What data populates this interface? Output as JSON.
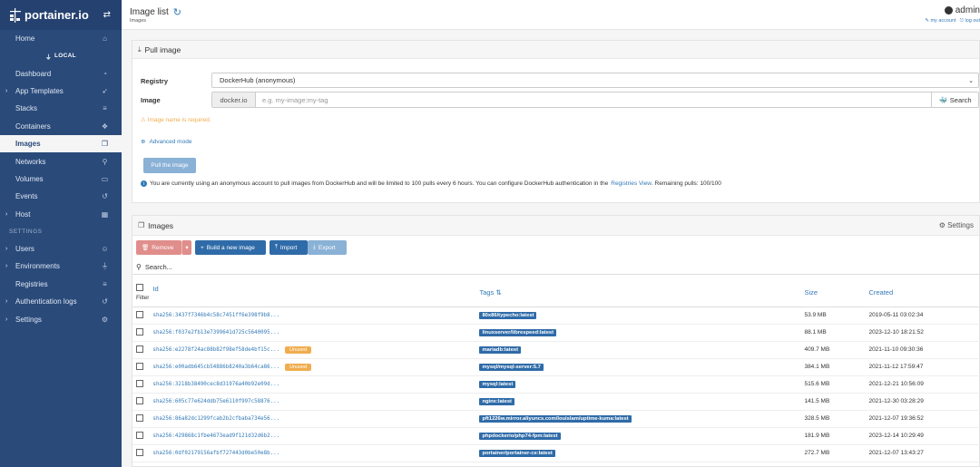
{
  "app": {
    "name": "portainer.io"
  },
  "sidebar": {
    "local_label": "LOCAL",
    "settings_section": "SETTINGS",
    "items": [
      {
        "label": "Home",
        "icon": "home-icon",
        "glyph": "⌂"
      },
      {
        "label": "Dashboard",
        "icon": "tachometer-icon",
        "glyph": "◔"
      },
      {
        "label": "App Templates",
        "icon": "rocket-icon",
        "glyph": "➶"
      },
      {
        "label": "Stacks",
        "icon": "list-icon",
        "glyph": "≡"
      },
      {
        "label": "Containers",
        "icon": "cubes-icon",
        "glyph": "❖"
      },
      {
        "label": "Images",
        "icon": "clone-icon",
        "glyph": "❐"
      },
      {
        "label": "Networks",
        "icon": "sitemap-icon",
        "glyph": "⚲"
      },
      {
        "label": "Volumes",
        "icon": "hdd-icon",
        "glyph": "▭"
      },
      {
        "label": "Events",
        "icon": "history-icon",
        "glyph": "↺"
      },
      {
        "label": "Host",
        "icon": "th-icon",
        "glyph": "▦"
      },
      {
        "label": "Users",
        "icon": "users-icon",
        "glyph": "☺"
      },
      {
        "label": "Environments",
        "icon": "plug-icon",
        "glyph": "⏚"
      },
      {
        "label": "Registries",
        "icon": "database-icon",
        "glyph": "≡"
      },
      {
        "label": "Authentication logs",
        "icon": "history-icon",
        "glyph": "↺"
      },
      {
        "label": "Settings",
        "icon": "cogs-icon",
        "glyph": "⚙"
      }
    ]
  },
  "header": {
    "title": "Image list",
    "subtitle": "Images",
    "user": "admin",
    "my_account": "my account",
    "log_out": "log out"
  },
  "pull": {
    "title": "Pull image",
    "registry_label": "Registry",
    "registry_value": "DockerHub (anonymous)",
    "image_label": "Image",
    "image_prefix": "docker.io",
    "image_placeholder": "e.g. my-image:my-tag",
    "search_label": "Search",
    "warning": "Image name is required.",
    "advanced_mode": "Advanced mode",
    "pull_button": "Pull the image",
    "info_text": "You are currently using an anonymous account to pull images from DockerHub and will be limited to 100 pulls every 6 hours. You can configure DockerHub authentication in the",
    "info_link": "Registries View",
    "info_remaining": ". Remaining pulls: 100/100"
  },
  "images": {
    "title": "Images",
    "settings_label": "Settings",
    "toolbar": {
      "remove": "Remove",
      "build": "Build a new image",
      "import": "Import",
      "export": "Export"
    },
    "search_placeholder": "Search...",
    "columns": {
      "id": "Id",
      "filter": "Filter",
      "tags": "Tags",
      "size": "Size",
      "created": "Created"
    },
    "rows": [
      {
        "id": "sha256:3437f7346b4c58c7451ff6e398f9b8...",
        "unused": "",
        "tag": "80x86/typecho:latest",
        "size": "53.9 MB",
        "created": "2019-05-11 03:02:34"
      },
      {
        "id": "sha256:f037e2fb13e7399641d725c5640095...",
        "unused": "",
        "tag": "linuxserver/librespeed:latest",
        "size": "88.1 MB",
        "created": "2023-12-10 18:21:52"
      },
      {
        "id": "sha256:e2278f24ac88b82f98ef58de4bf15c...",
        "unused": "Unused",
        "tag": "mariadb:latest",
        "size": "409.7 MB",
        "created": "2021-11-10 09:30:36"
      },
      {
        "id": "sha256:e00adb645cb54886b8240a3b64ca86...",
        "unused": "Unused",
        "tag": "mysql/mysql-server:5.7",
        "size": "384.1 MB",
        "created": "2021-11-12 17:59:47"
      },
      {
        "id": "sha256:3218b38490cec8d31976a40b92e09d...",
        "unused": "",
        "tag": "mysql:latest",
        "size": "515.6 MB",
        "created": "2021-12-21 10:56:09"
      },
      {
        "id": "sha256:605c77e624ddb75e6110f997c58876...",
        "unused": "",
        "tag": "nginx:latest",
        "size": "141.5 MB",
        "created": "2021-12-30 03:28:29"
      },
      {
        "id": "sha256:86a82dc1299fcab2b2cfbaba734e56...",
        "unused": "",
        "tag": "pft1226w.mirror.aliyuncs.com/louislam/uptime-kuma:latest",
        "size": "328.5 MB",
        "created": "2021-12-07 19:36:52"
      },
      {
        "id": "sha256:429868c1fbe4673ead9f121d32d6b2...",
        "unused": "",
        "tag": "phpdockerio/php74-fpm:latest",
        "size": "181.9 MB",
        "created": "2023-12-14 10:29:49"
      },
      {
        "id": "sha256:0df02179156afbf727443d0be50e8b...",
        "unused": "",
        "tag": "portainer/portainer-ce:latest",
        "size": "272.7 MB",
        "created": "2021-12-07 13:43:27"
      }
    ]
  }
}
